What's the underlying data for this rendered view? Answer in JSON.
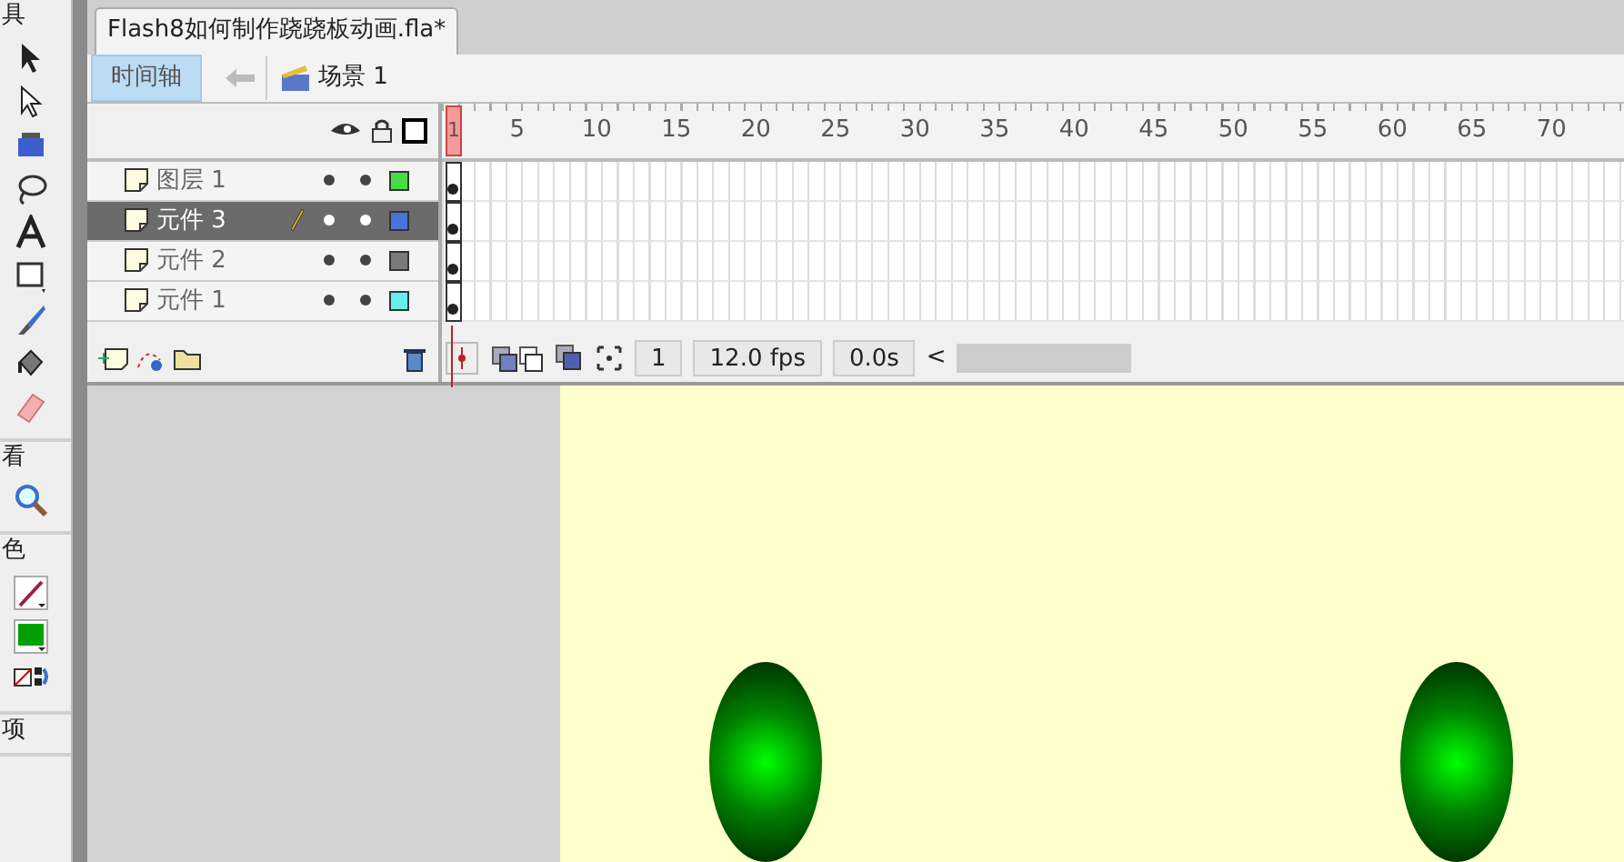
{
  "tools": {
    "sections": [
      {
        "label": "具",
        "items": [
          {
            "kind": "selection"
          },
          {
            "kind": "subselection"
          },
          {
            "kind": "transform"
          },
          {
            "kind": "lasso"
          },
          {
            "kind": "text"
          },
          {
            "kind": "rectangle"
          },
          {
            "kind": "brush"
          },
          {
            "kind": "bucket"
          },
          {
            "kind": "eraser"
          }
        ]
      },
      {
        "label": "看",
        "items": [
          {
            "kind": "zoom"
          }
        ]
      },
      {
        "label": "色",
        "items": [
          {
            "kind": "stroke"
          },
          {
            "kind": "fill"
          },
          {
            "kind": "swap"
          }
        ]
      },
      {
        "label": "项"
      }
    ]
  },
  "document_tab": {
    "title": "Flash8如何制作跷跷板动画.fla*"
  },
  "edit_bar": {
    "timeline_button": {
      "label": "时间轴",
      "selected": true
    },
    "back_disabled": true,
    "scene": "场景 1"
  },
  "layers": [
    {
      "name": "图层 1",
      "selected": false,
      "editing": false,
      "color": "#44dd44"
    },
    {
      "name": "元件 3",
      "selected": true,
      "editing": true,
      "color": "#4a72dc"
    },
    {
      "name": "元件 2",
      "selected": false,
      "editing": false,
      "color": "#7a7a7a"
    },
    {
      "name": "元件 1",
      "selected": false,
      "editing": false,
      "color": "#66eeee"
    }
  ],
  "ruler": [
    "1",
    "5",
    "10",
    "15",
    "20",
    "25",
    "30",
    "35",
    "40",
    "45",
    "50",
    "55",
    "60",
    "65",
    "70"
  ],
  "status": {
    "current_frame": "1",
    "frame_rate": "12.0 fps",
    "elapsed": "0.0s",
    "scroll_left": "<"
  }
}
